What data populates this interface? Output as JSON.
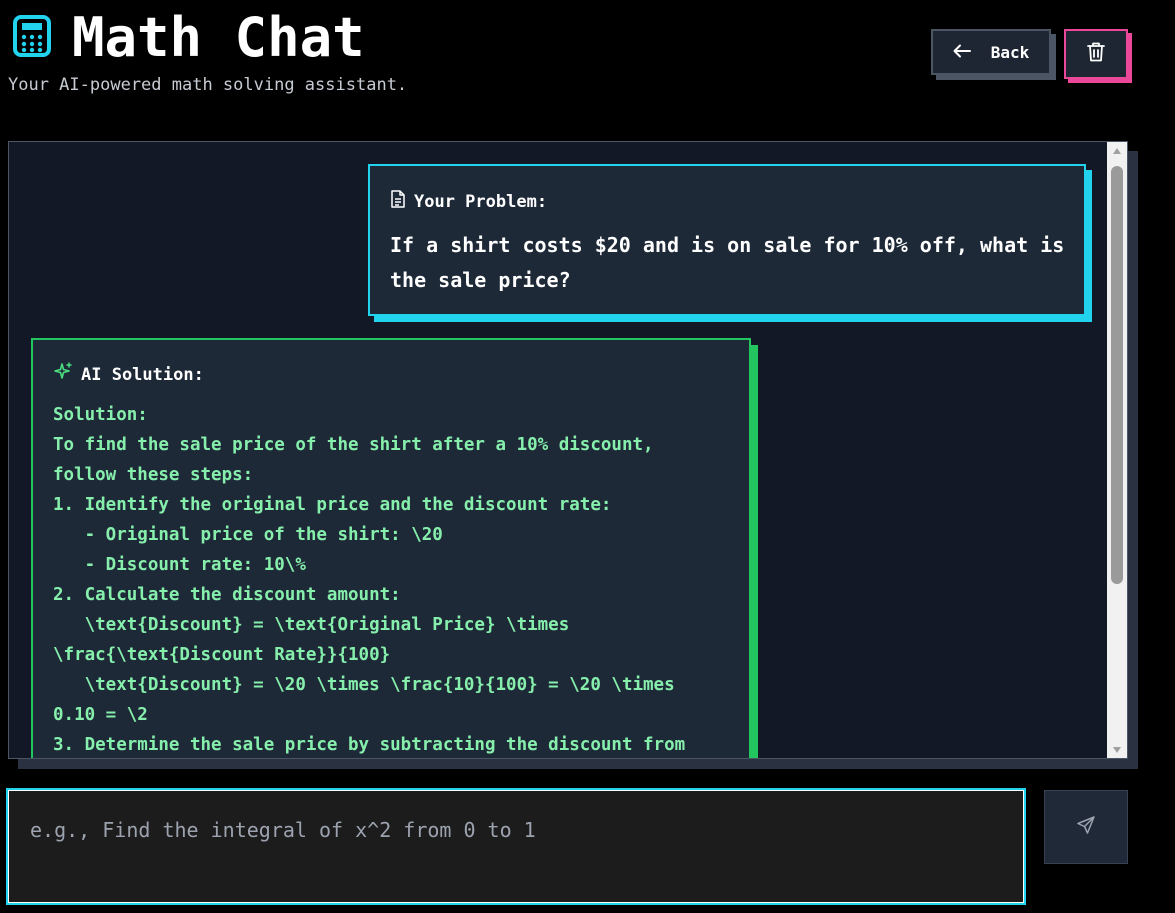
{
  "header": {
    "title": "Math Chat",
    "subtitle": "Your AI-powered math solving assistant.",
    "logo_icon": "calculator-icon",
    "back_label": "Back",
    "back_icon": "arrow-left-icon",
    "clear_icon": "trash-icon"
  },
  "colors": {
    "accent_cyan": "#22d3ee",
    "accent_green": "#22c55e",
    "accent_pink": "#ec4899",
    "solution_text": "#86efac"
  },
  "chat": {
    "user_message": {
      "heading": "Your Problem:",
      "icon": "document-icon",
      "text": "If a shirt costs $20 and is on sale for 10% off, what is the sale price?"
    },
    "ai_message": {
      "heading": "AI Solution:",
      "icon": "sparkles-icon",
      "lines": [
        "Solution:",
        "To find the sale price of the shirt after a 10% discount,",
        "follow these steps:",
        "1. Identify the original price and the discount rate:",
        "   - Original price of the shirt: \\20",
        "   - Discount rate: 10\\%",
        "2. Calculate the discount amount:",
        "   \\text{Discount} = \\text{Original Price} \\times",
        "\\frac{\\text{Discount Rate}}{100}",
        "   \\text{Discount} = \\20 \\times \\frac{10}{100} = \\20 \\times",
        "0.10 = \\2",
        "3. Determine the sale price by subtracting the discount from"
      ]
    }
  },
  "composer": {
    "placeholder": "e.g., Find the integral of x^2 from 0 to 1",
    "value": "",
    "send_icon": "send-icon"
  }
}
